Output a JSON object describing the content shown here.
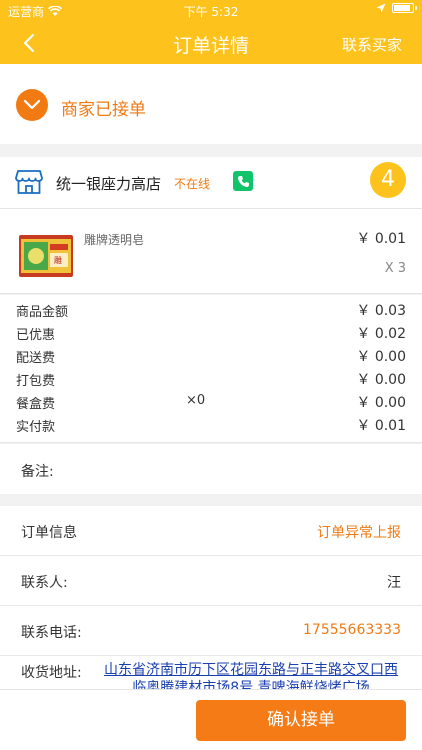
{
  "status_bar": {
    "carrier": "运营商",
    "time": "下午 5:32"
  },
  "nav": {
    "title": "订单详情",
    "right_action": "联系买家"
  },
  "order_status": {
    "text": "商家已接单"
  },
  "shop": {
    "name": "统一银座力高店",
    "status": "不在线",
    "badge": "4"
  },
  "product": {
    "name": "雕牌透明皂",
    "price": "￥ 0.01",
    "qty": "X 3"
  },
  "fees": [
    {
      "label": "商品金额",
      "mid": "",
      "value": "￥ 0.03"
    },
    {
      "label": "已优惠",
      "mid": "",
      "value": "￥ 0.02"
    },
    {
      "label": "配送费",
      "mid": "",
      "value": "￥ 0.00"
    },
    {
      "label": "打包费",
      "mid": "",
      "value": "￥ 0.00"
    },
    {
      "label": "餐盒费",
      "mid": "×0",
      "value": "￥ 0.00"
    },
    {
      "label": "实付款",
      "mid": "",
      "value": "￥ 0.01"
    }
  ],
  "note": {
    "label": "备注:"
  },
  "info": {
    "order_info_label": "订单信息",
    "report_link": "订单异常上报",
    "contact_label": "联系人:",
    "contact_value": "汪",
    "phone_label": "联系电话:",
    "phone_value": "17555663333",
    "address_label": "收货地址:",
    "address_value": "山东省济南市历下区花园东路与正丰路交叉口西临奥腾建材市场8号 青啤海鲜烧烤广场"
  },
  "confirm_button": "确认接单",
  "colors": {
    "header": "#fdc21b",
    "accent": "#f07a14",
    "button": "#f47b16",
    "phone": "#11c46c",
    "link": "#1a3fb0"
  }
}
